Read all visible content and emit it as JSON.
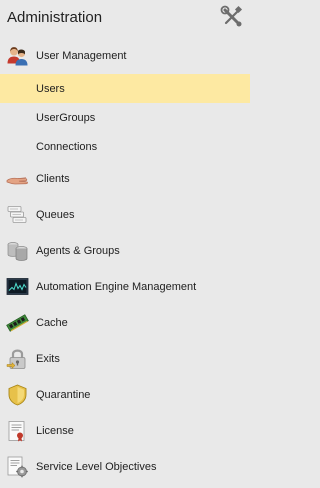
{
  "header": {
    "title": "Administration",
    "tools_icon": "tools-icon"
  },
  "menu": {
    "user_management": {
      "label": "User Management",
      "icon": "users-icon"
    },
    "users": {
      "label": "Users"
    },
    "usergroups": {
      "label": "UserGroups"
    },
    "connections": {
      "label": "Connections"
    },
    "clients": {
      "label": "Clients",
      "icon": "hand-icon"
    },
    "queues": {
      "label": "Queues",
      "icon": "queue-icon"
    },
    "agents": {
      "label": "Agents & Groups",
      "icon": "server-icon"
    },
    "automation": {
      "label": "Automation Engine Management",
      "icon": "monitor-icon"
    },
    "cache": {
      "label": "Cache",
      "icon": "memory-icon"
    },
    "exits": {
      "label": "Exits",
      "icon": "padlock-icon"
    },
    "quarantine": {
      "label": "Quarantine",
      "icon": "shield-icon"
    },
    "license": {
      "label": "License",
      "icon": "certificate-icon"
    },
    "slo": {
      "label": "Service Level Objectives",
      "icon": "document-gear-icon"
    }
  },
  "colors": {
    "background": "#e9e9e9",
    "selected": "#fde9a2"
  }
}
